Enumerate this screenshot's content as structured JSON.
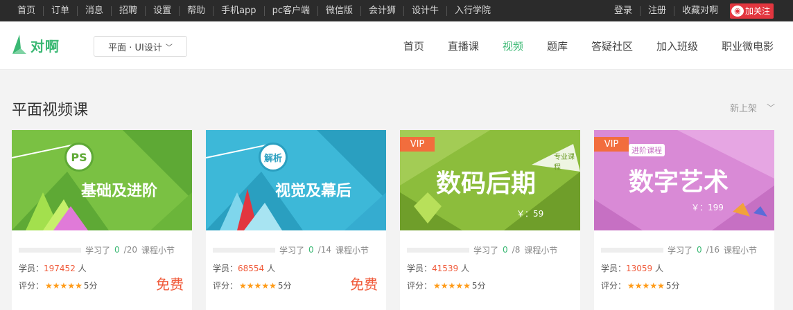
{
  "topbar": {
    "left_links": [
      "首页",
      "订单",
      "消息",
      "招聘",
      "设置",
      "帮助",
      "手机app",
      "pc客户端",
      "微信版",
      "会计狮",
      "设计牛",
      "入行学院"
    ],
    "right_links": [
      "登录",
      "注册",
      "收藏对啊"
    ],
    "weibo_label": "加关注"
  },
  "header": {
    "logo_text": "对啊",
    "category_select": "平面 · UI设计",
    "nav": [
      "首页",
      "直播课",
      "视频",
      "题库",
      "答疑社区",
      "加入班级",
      "职业微电影"
    ],
    "nav_active": "视频"
  },
  "section": {
    "title": "平面视频课",
    "sort_label": "新上架"
  },
  "labels": {
    "studied_prefix": "学习了",
    "lessons_suffix": "课程小节",
    "students_prefix": "学员：",
    "students_suffix": "人",
    "rating_prefix": "评分：",
    "free": "免费",
    "vip": "VIP"
  },
  "courses": [
    {
      "title": "基础及进阶",
      "badge": "PS",
      "vip": false,
      "price": "",
      "progress_done": "0",
      "progress_total": "/20",
      "progress": 0,
      "students": "197452",
      "rating": "5分",
      "free": true,
      "colors": {
        "bg": "#7ac143",
        "accent": "#5ea935"
      }
    },
    {
      "title": "视觉及幕后",
      "badge": "解析",
      "vip": false,
      "price": "",
      "progress_done": "0",
      "progress_total": "/14",
      "progress": 0,
      "students": "68554",
      "rating": "5分",
      "free": true,
      "colors": {
        "bg": "#3db8d8",
        "accent": "#2a9fc0"
      }
    },
    {
      "title": "数码后期",
      "badge": "专业课程",
      "vip": true,
      "price": "￥：59",
      "progress_done": "0",
      "progress_total": "/8",
      "progress": 0,
      "students": "41539",
      "rating": "5分",
      "free": false,
      "colors": {
        "bg": "#8cbd3c",
        "accent": "#6f9e2a"
      }
    },
    {
      "title": "数字艺术",
      "badge": "进阶课程",
      "vip": true,
      "price": "￥：199",
      "progress_done": "0",
      "progress_total": "/16",
      "progress": 0,
      "students": "13059",
      "rating": "5分",
      "free": false,
      "colors": {
        "bg": "#d98ad6",
        "accent": "#c670c3"
      }
    }
  ]
}
